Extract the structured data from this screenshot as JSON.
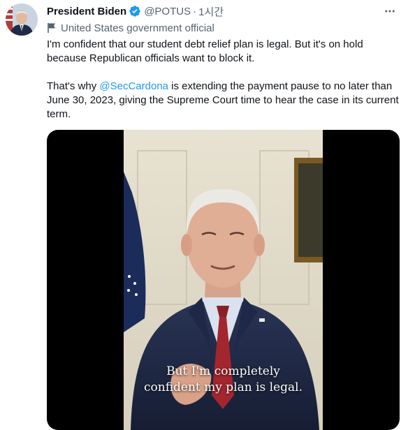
{
  "author": {
    "display_name": "President Biden",
    "handle": "@POTUS",
    "separator": "·",
    "time": "1시간",
    "label": "United States government official"
  },
  "tweet": {
    "para1": "I'm confident that our student debt relief plan is legal. But it's on hold because Republican officials want to block it.",
    "para2_before": "That's why ",
    "mention": "@SecCardona",
    "para2_after": " is extending the payment pause to no later than June 30, 2023, giving the Supreme Court time to hear the case in its current term."
  },
  "media": {
    "caption_line1": "But I'm completely",
    "caption_line2": "confident my plan is legal."
  },
  "icons": {
    "verified": "verified-badge-icon",
    "label": "flag-icon",
    "more": "more-options-icon"
  },
  "colors": {
    "text": "#0f1419",
    "secondary": "#536471",
    "accent": "#1d9bf0"
  }
}
